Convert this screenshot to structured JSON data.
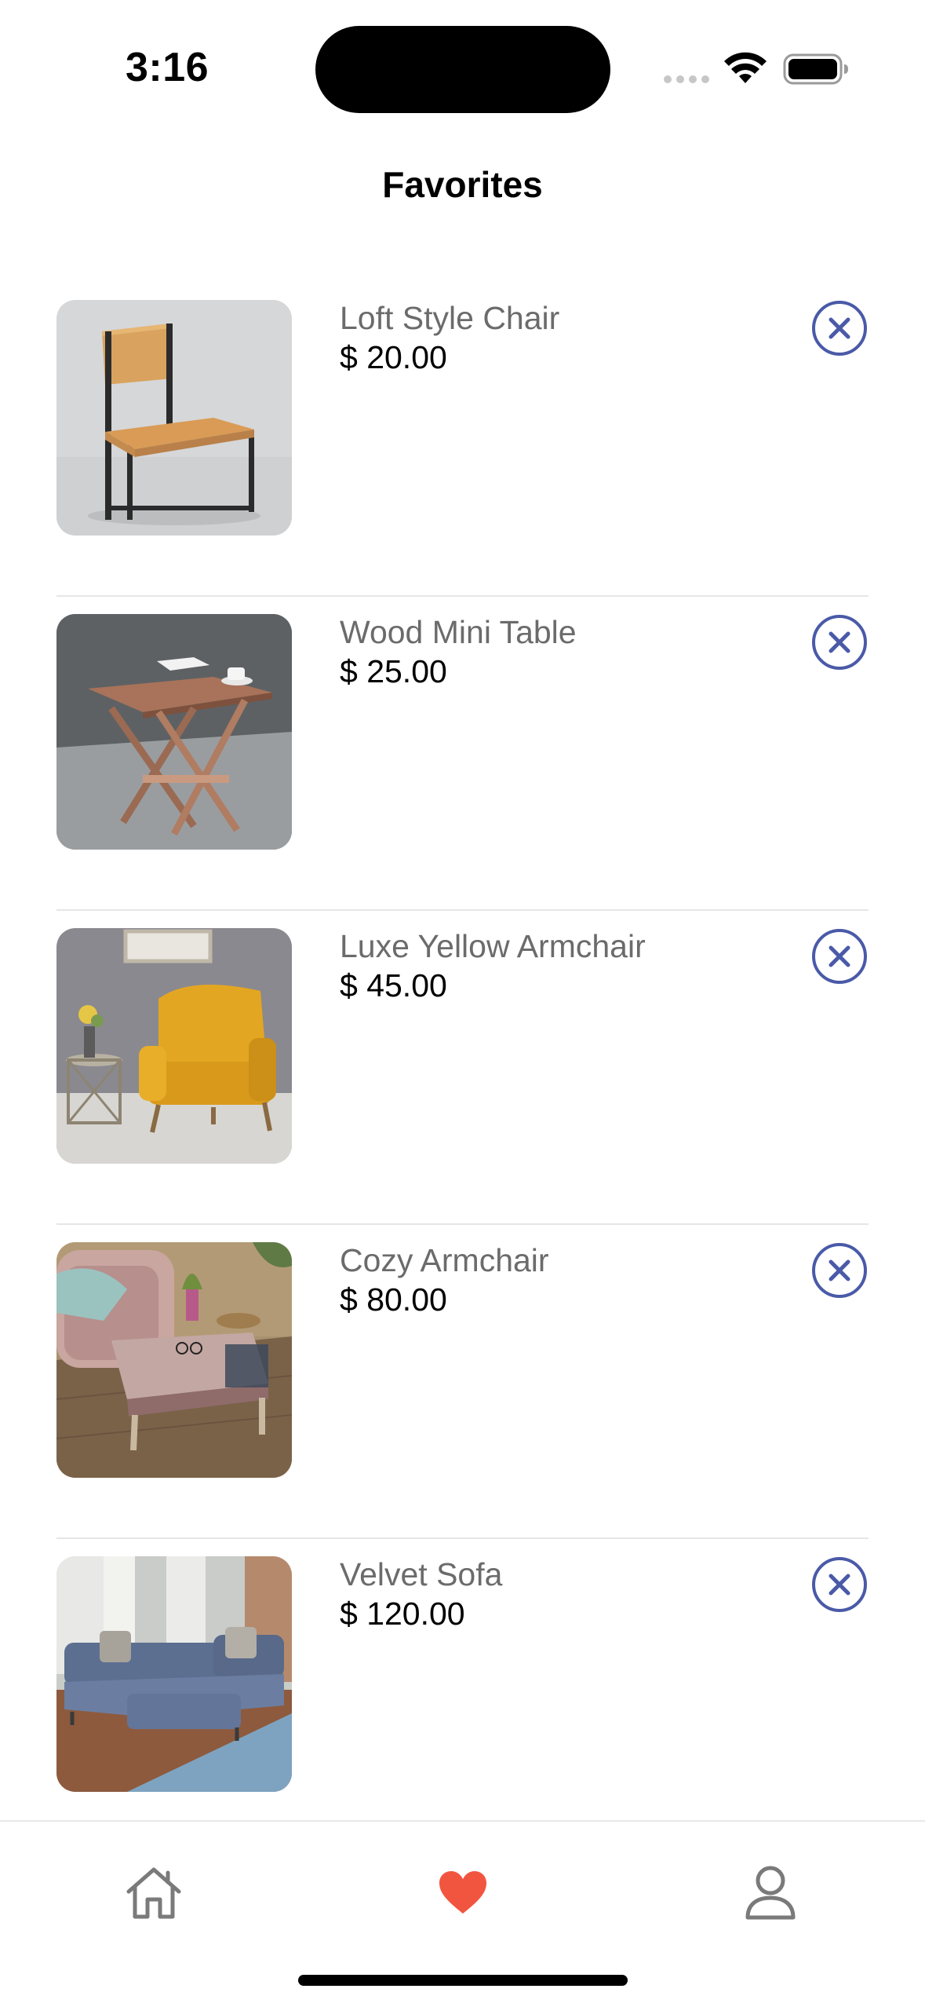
{
  "status_bar": {
    "time": "3:16"
  },
  "header": {
    "title": "Favorites"
  },
  "favorites": [
    {
      "name": "Loft Style Chair",
      "price": "$ 20.00",
      "image": "chair-photo"
    },
    {
      "name": "Wood Mini Table",
      "price": "$ 25.00",
      "image": "table-photo"
    },
    {
      "name": "Luxe Yellow Armchair",
      "price": "$ 45.00",
      "image": "yellow-armchair-photo"
    },
    {
      "name": "Cozy Armchair",
      "price": "$ 80.00",
      "image": "patterned-armchair-photo"
    },
    {
      "name": "Velvet Sofa",
      "price": "$ 120.00",
      "image": "blue-sofa-photo"
    }
  ],
  "tab_bar": {
    "items": [
      {
        "icon": "home-icon",
        "active": false
      },
      {
        "icon": "heart-icon",
        "active": true
      },
      {
        "icon": "person-icon",
        "active": false
      }
    ]
  },
  "colors": {
    "remove_accent": "#4a5aa8",
    "active_tab": "#f2553f",
    "inactive_tab": "#7a7a7a",
    "name_text": "#6b6b6b",
    "price_text": "#000000"
  }
}
